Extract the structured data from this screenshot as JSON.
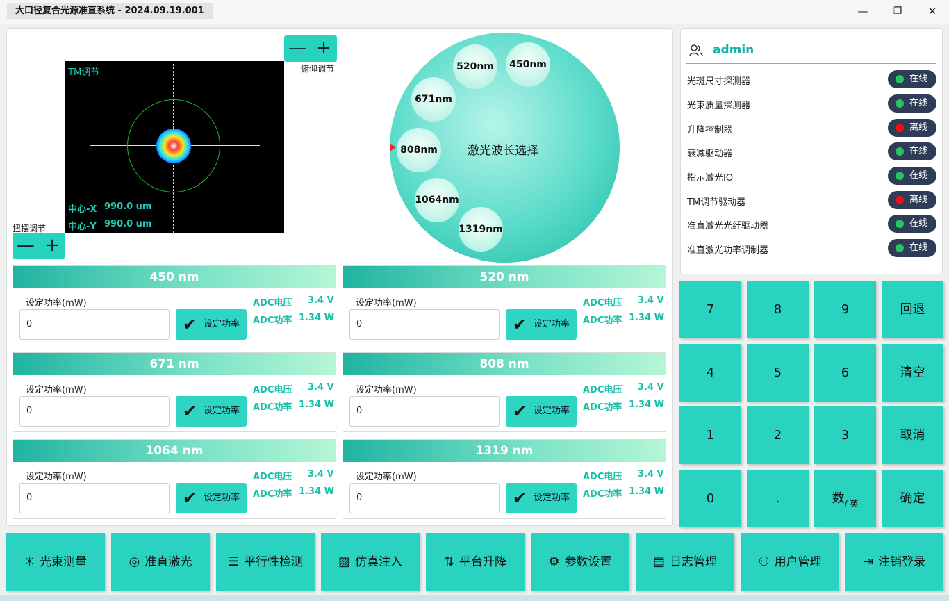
{
  "window": {
    "title": "大口径复合光源准直系统 - 2024.09.19.001",
    "minimize": "—",
    "restore": "❐",
    "close": "✕"
  },
  "beam_view": {
    "tag": "TM调节",
    "center_x_label": "中心-X",
    "center_x_value": "990.0 um",
    "center_y_label": "中心-Y",
    "center_y_value": "990.0 um"
  },
  "pitch": {
    "label": "俯仰调节",
    "minus": "—",
    "plus": "+"
  },
  "swing": {
    "label": "扭摆调节",
    "minus": "—",
    "plus": "+"
  },
  "wheel": {
    "title": "激光波长选择",
    "wavelengths": [
      "520nm",
      "450nm",
      "671nm",
      "808nm",
      "1064nm",
      "1319nm"
    ]
  },
  "cards": [
    {
      "title": "450 nm",
      "field_label": "设定功率(mW)",
      "value": "0",
      "button": "设定功率",
      "adc_v_label": "ADC电压",
      "adc_v": "3.4 V",
      "adc_p_label": "ADC功率",
      "adc_p": "1.34 W"
    },
    {
      "title": "520 nm",
      "field_label": "设定功率(mW)",
      "value": "0",
      "button": "设定功率",
      "adc_v_label": "ADC电压",
      "adc_v": "3.4 V",
      "adc_p_label": "ADC功率",
      "adc_p": "1.34 W"
    },
    {
      "title": "671 nm",
      "field_label": "设定功率(mW)",
      "value": "0",
      "button": "设定功率",
      "adc_v_label": "ADC电压",
      "adc_v": "3.4 V",
      "adc_p_label": "ADC功率",
      "adc_p": "1.34 W"
    },
    {
      "title": "808 nm",
      "field_label": "设定功率(mW)",
      "value": "0",
      "button": "设定功率",
      "adc_v_label": "ADC电压",
      "adc_v": "3.4 V",
      "adc_p_label": "ADC功率",
      "adc_p": "1.34 W"
    },
    {
      "title": "1064 nm",
      "field_label": "设定功率(mW)",
      "value": "0",
      "button": "设定功率",
      "adc_v_label": "ADC电压",
      "adc_v": "3.4 V",
      "adc_p_label": "ADC功率",
      "adc_p": "1.34 W"
    },
    {
      "title": "1319 nm",
      "field_label": "设定功率(mW)",
      "value": "0",
      "button": "设定功率",
      "adc_v_label": "ADC电压",
      "adc_v": "3.4 V",
      "adc_p_label": "ADC功率",
      "adc_p": "1.34 W"
    }
  ],
  "user": {
    "name": "admin",
    "icon": "user-icon"
  },
  "devices": [
    {
      "name": "光斑尺寸探测器",
      "status": "在线",
      "color": "#22c55e"
    },
    {
      "name": "光束质量探测器",
      "status": "在线",
      "color": "#22c55e"
    },
    {
      "name": "升降控制器",
      "status": "离线",
      "color": "#ee1111"
    },
    {
      "name": "衰减驱动器",
      "status": "在线",
      "color": "#22c55e"
    },
    {
      "name": "指示激光IO",
      "status": "在线",
      "color": "#22c55e"
    },
    {
      "name": "TM调节驱动器",
      "status": "离线",
      "color": "#ee1111"
    },
    {
      "name": "准直激光光纤驱动器",
      "status": "在线",
      "color": "#22c55e"
    },
    {
      "name": "准直激光功率调制器",
      "status": "在线",
      "color": "#22c55e"
    }
  ],
  "keypad": {
    "k7": "7",
    "k8": "8",
    "k9": "9",
    "back": "回退",
    "k4": "4",
    "k5": "5",
    "k6": "6",
    "clear": "清空",
    "k1": "1",
    "k2": "2",
    "k3": "3",
    "cancel": "取消",
    "k0": "0",
    "dot": ".",
    "mode_main": "数",
    "mode_sub": "/ 英",
    "ok": "确定"
  },
  "nav": [
    {
      "label": "光束测量",
      "icon": "sparkle-icon",
      "glyph": "✳"
    },
    {
      "label": "准直激光",
      "icon": "target-icon",
      "glyph": "◎"
    },
    {
      "label": "平行性检测",
      "icon": "lines-icon",
      "glyph": "☰"
    },
    {
      "label": "仿真注入",
      "icon": "image-icon",
      "glyph": "▨"
    },
    {
      "label": "平台升降",
      "icon": "lift-icon",
      "glyph": "⇅"
    },
    {
      "label": "参数设置",
      "icon": "gear-icon",
      "glyph": "⚙"
    },
    {
      "label": "日志管理",
      "icon": "clipboard-icon",
      "glyph": "▤"
    },
    {
      "label": "用户管理",
      "icon": "users-icon",
      "glyph": "⚇"
    },
    {
      "label": "注销登录",
      "icon": "logout-icon",
      "glyph": "⇥"
    }
  ],
  "colors": {
    "accent": "#2ad3bf",
    "online": "#22c55e",
    "offline": "#ee1111",
    "badge": "#2e3c58"
  }
}
